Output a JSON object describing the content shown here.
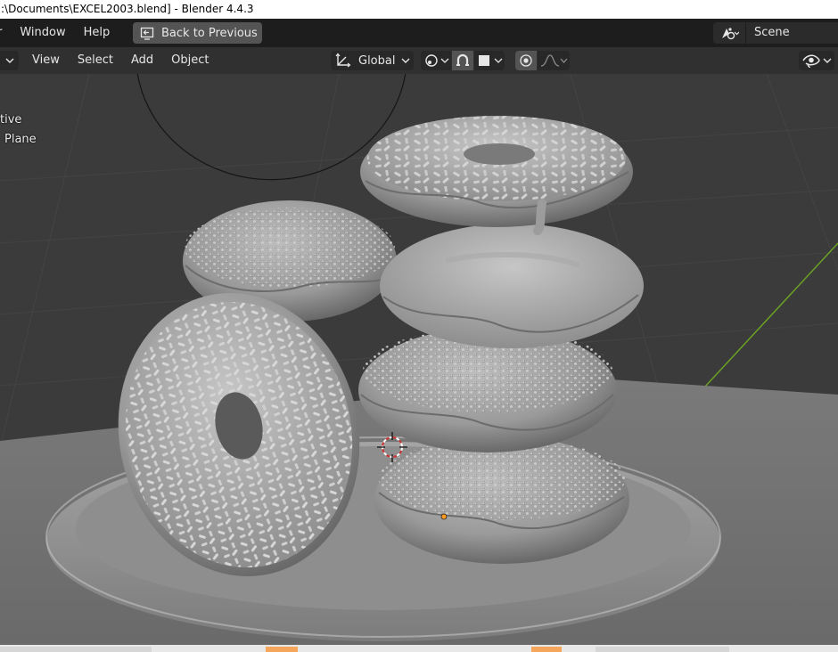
{
  "window": {
    "title": ":\\Documents\\EXCEL2003.blend] - Blender 4.4.3"
  },
  "menubar": {
    "items": [
      "r",
      "Window",
      "Help"
    ],
    "back_button": "Back to Previous",
    "scene_name": "Scene"
  },
  "viewport_header": {
    "menu": [
      "View",
      "Select",
      "Add",
      "Object"
    ],
    "transform_orientation": "Global"
  },
  "viewport": {
    "overlay_lines": [
      "tive",
      "Plane"
    ]
  },
  "colors": {
    "menubar_bg": "#1d1d1d",
    "header_bg": "#303030",
    "viewport_bg": "#3b3b3b",
    "x_axis": "#a33c3c",
    "y_axis": "#6ba124",
    "button_bg": "#545454",
    "origin": "#ff9a21",
    "frame_marker": "#f5a65b"
  },
  "icons": [
    "back-to-previous-icon",
    "scene-icon",
    "transform-orientation-icon",
    "snap-icon",
    "proportional-editing-icon",
    "visibility-icon"
  ]
}
